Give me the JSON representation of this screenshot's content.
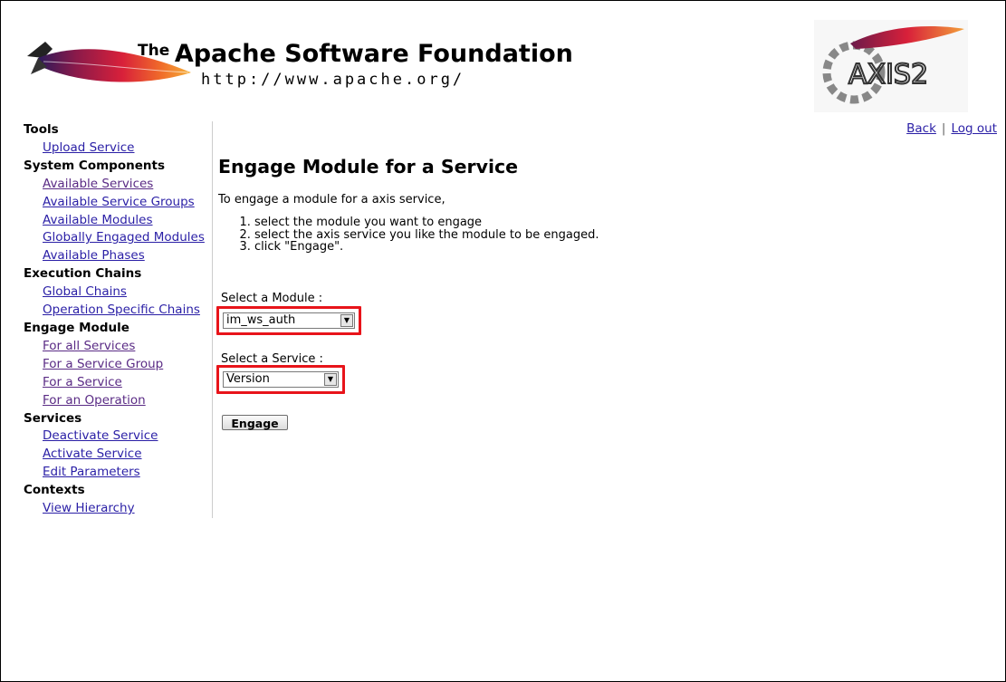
{
  "header": {
    "asf_the": "The",
    "asf_name": "Apache Software Foundation",
    "asf_url": "http://www.apache.org/",
    "axis_logo_text": "AXIS2"
  },
  "toplinks": {
    "back": "Back",
    "separator": "|",
    "logout": "Log out"
  },
  "sidebar": {
    "sections": [
      {
        "heading": "Tools",
        "links": [
          "Upload Service"
        ]
      },
      {
        "heading": "System Components",
        "links": [
          "Available Services",
          "Available Service Groups",
          "Available Modules",
          "Globally Engaged Modules",
          "Available Phases"
        ]
      },
      {
        "heading": "Execution Chains",
        "links": [
          "Global Chains",
          "Operation Specific Chains"
        ]
      },
      {
        "heading": "Engage Module",
        "links": [
          "For all Services",
          "For a Service Group",
          "For a Service",
          "For an Operation"
        ]
      },
      {
        "heading": "Services",
        "links": [
          "Deactivate Service",
          "Activate Service",
          "Edit Parameters"
        ]
      },
      {
        "heading": "Contexts",
        "links": [
          "View Hierarchy"
        ]
      }
    ]
  },
  "main": {
    "title": "Engage Module for a Service",
    "intro": "To engage a module for a axis service,",
    "steps": [
      "select the module you want to engage",
      "select the axis service you like the module to be engaged.",
      "click \"Engage\"."
    ],
    "module_label": "Select a Module :",
    "module_value": "im_ws_auth",
    "service_label": "Select a Service :",
    "service_value": "Version",
    "engage_button": "Engage"
  },
  "colors": {
    "link": "#2a1fa6",
    "highlight": "#e8141a"
  }
}
